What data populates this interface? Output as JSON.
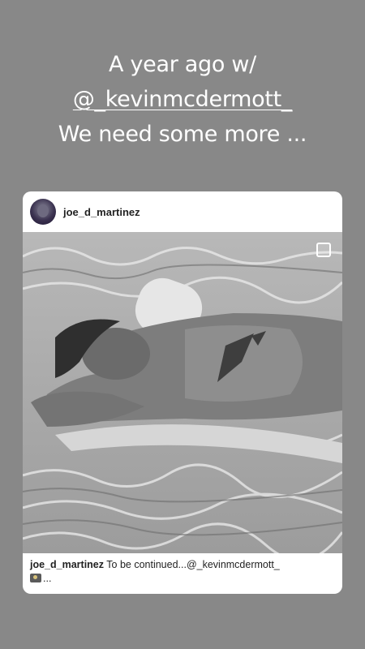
{
  "story": {
    "line1": "A year ago w/",
    "mention": "@_kevinmcdermott_",
    "line3": "We need some more ..."
  },
  "post": {
    "username": "joe_d_martinez",
    "caption_user": "joe_d_martinez",
    "caption_text": " To be continued...@_kevinmcdermott_",
    "caption_tail": "..."
  },
  "photo": {
    "icon": "select-square-icon"
  },
  "colors": {
    "background": "#888888",
    "card": "#ffffff",
    "text": "#ffffff"
  }
}
